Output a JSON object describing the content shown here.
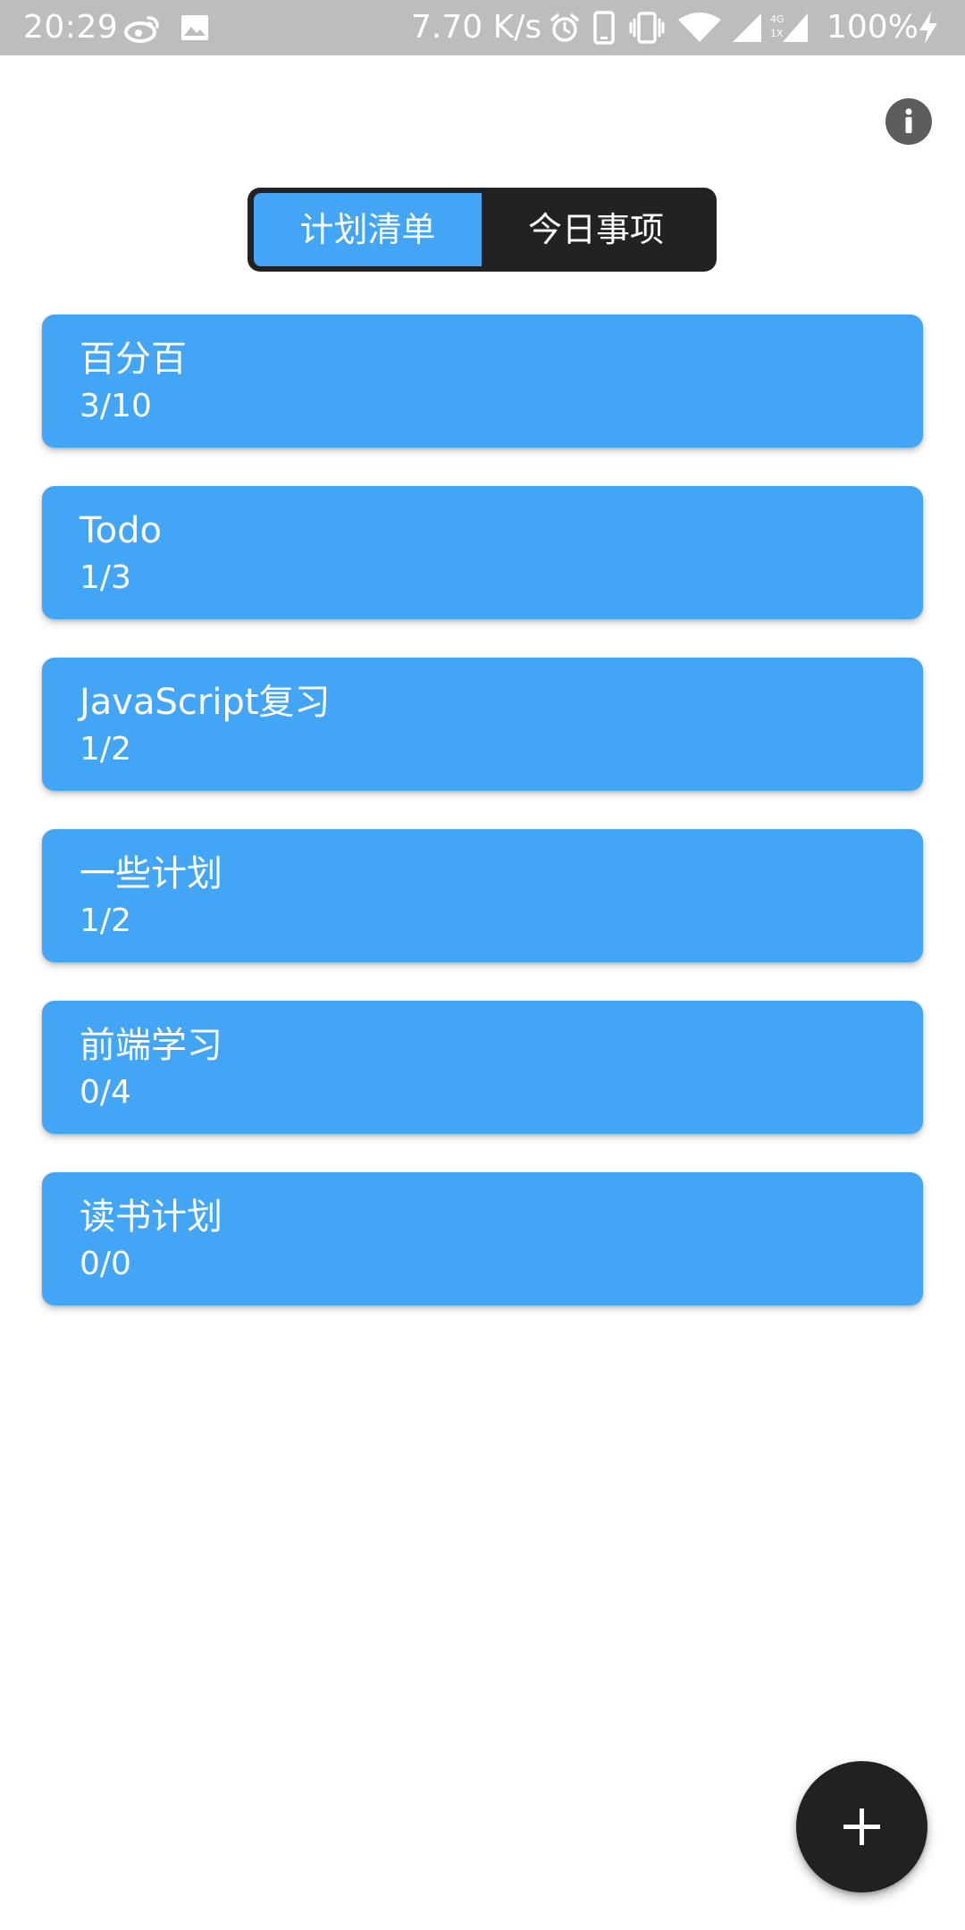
{
  "status_bar": {
    "time": "20:29",
    "network_speed": "7.70 K/s",
    "battery_percent": "100%",
    "icons": [
      "weibo-icon",
      "image-icon",
      "alarm-icon",
      "phone-icon",
      "vibrate-icon",
      "wifi-icon",
      "signal-icon",
      "signal-4g-icon",
      "charging-icon"
    ]
  },
  "header": {
    "info_icon": "info-icon"
  },
  "tabs": [
    {
      "label": "计划清单",
      "active": true
    },
    {
      "label": "今日事项",
      "active": false
    }
  ],
  "plans": [
    {
      "title": "百分百",
      "progress": "3/10"
    },
    {
      "title": "Todo",
      "progress": "1/3"
    },
    {
      "title": "JavaScript复习",
      "progress": "1/2"
    },
    {
      "title": "一些计划",
      "progress": "1/2"
    },
    {
      "title": "前端学习",
      "progress": "0/4"
    },
    {
      "title": "读书计划",
      "progress": "0/0"
    }
  ],
  "fab": {
    "icon": "plus-icon"
  },
  "colors": {
    "accent": "#42a5f5",
    "dark": "#222222",
    "status_bar": "#bdbdbd",
    "info_button": "#5d5d5d"
  }
}
